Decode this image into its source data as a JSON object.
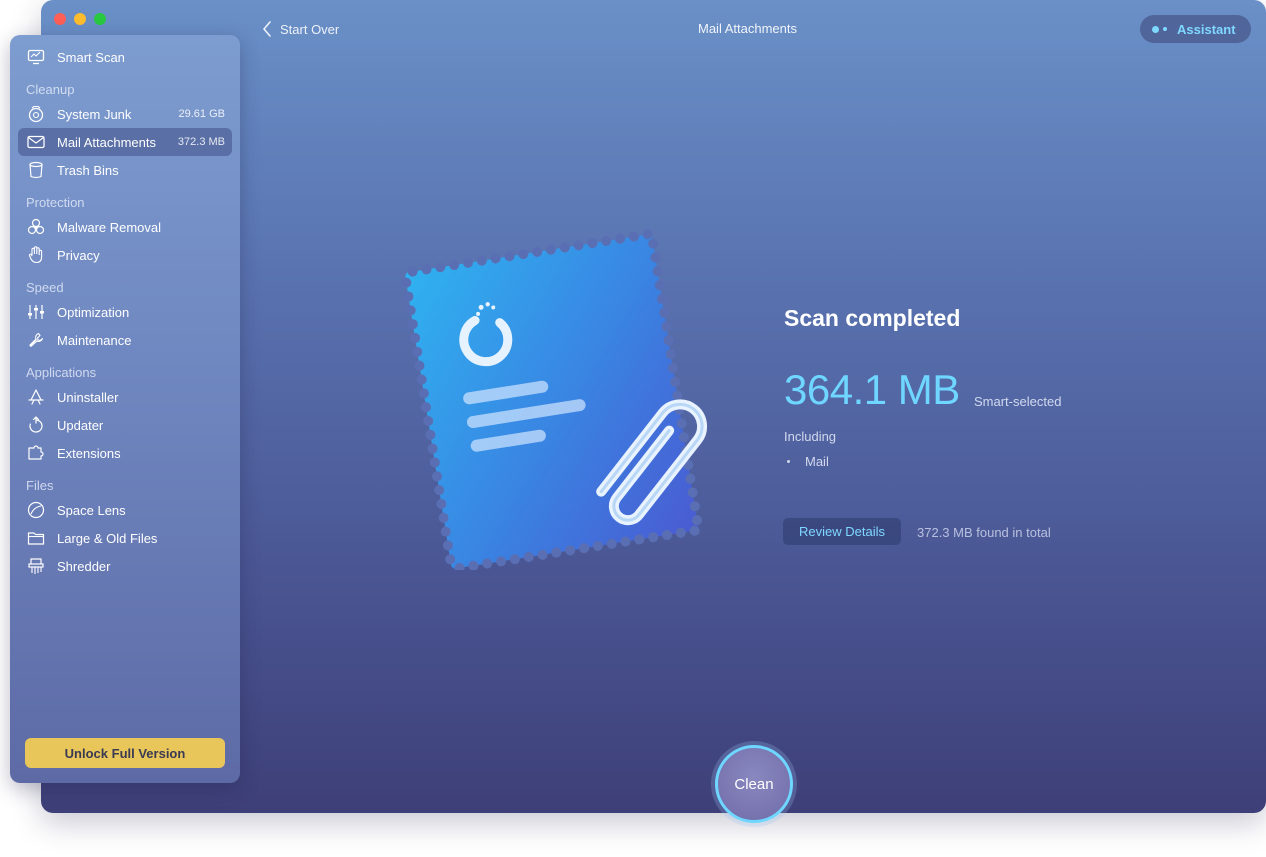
{
  "window": {
    "title": "Mail Attachments",
    "traffic_lights": [
      "close",
      "minimize",
      "zoom"
    ]
  },
  "topbar": {
    "back_label": "Start Over",
    "assistant_label": "Assistant"
  },
  "sidebar": {
    "smart_scan": {
      "label": "Smart Scan",
      "icon": "monitor-icon"
    },
    "sections": {
      "cleanup": "Cleanup",
      "protection": "Protection",
      "speed": "Speed",
      "applications": "Applications",
      "files": "Files"
    },
    "items": {
      "system_junk": {
        "label": "System Junk",
        "value": "29.61 GB",
        "icon": "junk-icon"
      },
      "mail_attachments": {
        "label": "Mail Attachments",
        "value": "372.3 MB",
        "icon": "envelope-icon",
        "active": true
      },
      "trash_bins": {
        "label": "Trash Bins",
        "icon": "trash-icon"
      },
      "malware_removal": {
        "label": "Malware Removal",
        "icon": "biohazard-icon"
      },
      "privacy": {
        "label": "Privacy",
        "icon": "hand-icon"
      },
      "optimization": {
        "label": "Optimization",
        "icon": "sliders-icon"
      },
      "maintenance": {
        "label": "Maintenance",
        "icon": "wrench-icon"
      },
      "uninstaller": {
        "label": "Uninstaller",
        "icon": "uninstaller-icon"
      },
      "updater": {
        "label": "Updater",
        "icon": "updater-icon"
      },
      "extensions": {
        "label": "Extensions",
        "icon": "puzzle-icon"
      },
      "space_lens": {
        "label": "Space Lens",
        "icon": "lens-icon"
      },
      "large_old_files": {
        "label": "Large & Old Files",
        "icon": "folder-icon"
      },
      "shredder": {
        "label": "Shredder",
        "icon": "shredder-icon"
      }
    },
    "unlock_label": "Unlock Full Version"
  },
  "main": {
    "status_title": "Scan completed",
    "size": "364.1 MB",
    "size_note": "Smart-selected",
    "including_label": "Including",
    "including_items": [
      "Mail"
    ],
    "review_label": "Review Details",
    "found_total": "372.3 MB found in total",
    "clean_label": "Clean"
  },
  "colors": {
    "accent": "#6fd7ff",
    "unlock_button": "#e8c65a",
    "window_top": "#6a90c7",
    "window_bottom": "#3e3f78"
  }
}
